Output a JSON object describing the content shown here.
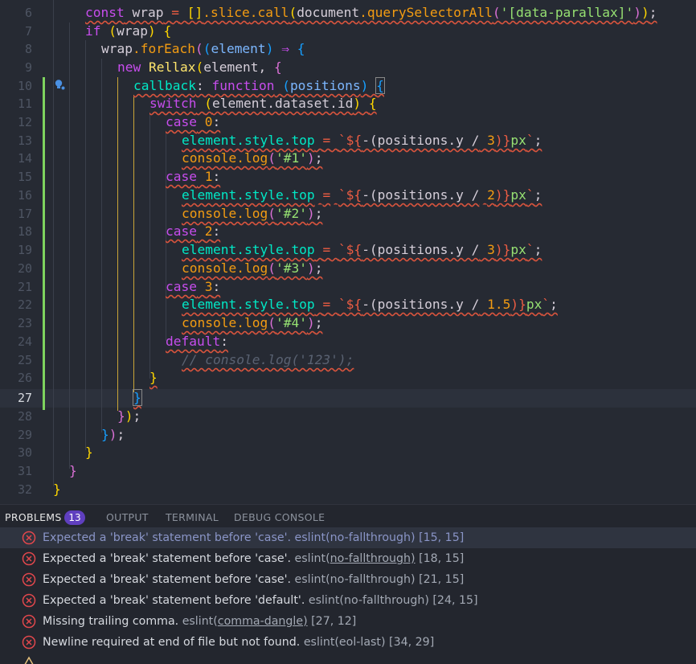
{
  "editor": {
    "lines": [
      {
        "n": "6"
      },
      {
        "n": "7"
      },
      {
        "n": "8"
      },
      {
        "n": "9"
      },
      {
        "n": "10"
      },
      {
        "n": "11"
      },
      {
        "n": "12"
      },
      {
        "n": "13"
      },
      {
        "n": "14"
      },
      {
        "n": "15"
      },
      {
        "n": "16"
      },
      {
        "n": "17"
      },
      {
        "n": "18"
      },
      {
        "n": "19"
      },
      {
        "n": "20"
      },
      {
        "n": "21"
      },
      {
        "n": "22"
      },
      {
        "n": "23"
      },
      {
        "n": "24"
      },
      {
        "n": "25"
      },
      {
        "n": "26"
      },
      {
        "n": "27"
      },
      {
        "n": "28"
      },
      {
        "n": "29"
      },
      {
        "n": "30"
      },
      {
        "n": "31"
      },
      {
        "n": "32"
      }
    ],
    "code": {
      "l6_const": "const",
      "l6_wrap": "wrap",
      "l6_eq": "=",
      "l6_arr": "[]",
      "l6_slice": ".slice",
      "l6_call": ".call",
      "l6_doc": "document",
      "l6_qsa": ".querySelectorAll",
      "l6_sel": "'[data-parallax]'",
      "l7_if": "if",
      "l7_wrap": "wrap",
      "l8_wrap": "wrap",
      "l8_foreach": ".forEach",
      "l8_element": "element",
      "l8_arrow": "⇒",
      "l9_new": "new",
      "l9_rellax": "Rellax",
      "l9_element": "element",
      "l10_callback": "callback",
      "l10_function": "function",
      "l10_positions": "positions",
      "l11_switch": "switch",
      "l11_expr": "element.dataset.id",
      "case_kw": "case",
      "case0": "0",
      "case1": "1",
      "case2": "2",
      "case3": "3",
      "el_style_top": "element.style.top",
      "eq": "=",
      "tpl_open": "`${",
      "minus_pos": "-(positions.y /",
      "div3": "3",
      "div2": "2",
      "div15": "1.5",
      "tpl_close": ")}",
      "px": "px",
      "tick": "`",
      "console_log": "console.log",
      "s1": "'#1'",
      "s2": "'#2'",
      "s3": "'#3'",
      "s4": "'#4'",
      "default_kw": "default",
      "comment": "// console.log('123');"
    }
  },
  "panel": {
    "tabs": [
      {
        "label": "PROBLEMS"
      },
      {
        "label": "OUTPUT"
      },
      {
        "label": "TERMINAL"
      },
      {
        "label": "DEBUG CONSOLE"
      }
    ],
    "problem_count": "13",
    "problems": [
      {
        "message": "Expected a 'break' statement before 'case'.",
        "source": "eslint(no-fallthrough)",
        "position": "[15, 15]"
      },
      {
        "message": "Expected a 'break' statement before 'case'.",
        "source_prefix": "eslint(",
        "source_link": "no-fallthrough)",
        "position": "[18, 15]"
      },
      {
        "message": "Expected a 'break' statement before 'case'.",
        "source": "eslint(no-fallthrough)",
        "position": "[21, 15]"
      },
      {
        "message": "Expected a 'break' statement before 'default'.",
        "source": "eslint(no-fallthrough)",
        "position": "[24, 15]"
      },
      {
        "message": "Missing trailing comma.",
        "source_prefix": "eslint(",
        "source_link": "comma-dangle)",
        "position": "[27, 12]"
      },
      {
        "message": "Newline required at end of file but not found.",
        "source": "eslint(eol-last)",
        "position": "[34, 29]"
      }
    ]
  },
  "colors": {
    "editor_bg": "#262a33",
    "error": "#e0474c",
    "badge": "#5f3fbf",
    "git_added": "#7ed35e"
  }
}
